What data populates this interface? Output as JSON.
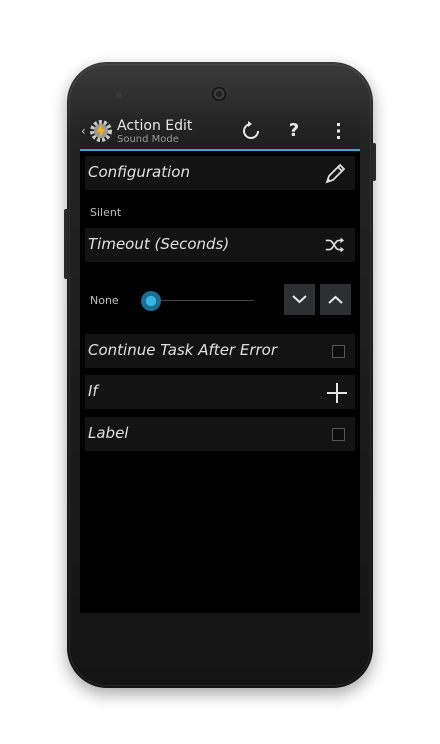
{
  "action_bar": {
    "title": "Action Edit",
    "subtitle": "Sound Mode",
    "help_label": "?",
    "accent_color": "#33a6d6"
  },
  "rows": {
    "configuration": "Configuration",
    "silent": "Silent",
    "timeout": "Timeout (Seconds)",
    "none": "None",
    "continue_task": "Continue Task After Error",
    "if": "If",
    "label": "Label"
  },
  "icons": {
    "back": "chevron-left-icon",
    "app": "tasker-gear-icon",
    "refresh": "refresh-icon",
    "help": "help-icon",
    "menu": "overflow-menu-icon",
    "edit": "pencil-icon",
    "shuffle": "shuffle-icon",
    "decrease": "chevron-down-icon",
    "increase": "chevron-up-icon",
    "add": "plus-icon"
  },
  "timeout_slider_value": 0
}
